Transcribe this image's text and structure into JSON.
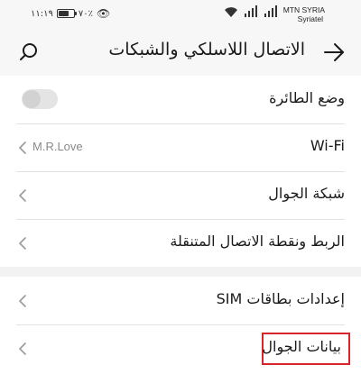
{
  "status_bar": {
    "time": "١١:١٩",
    "battery_text": "٧٠٪",
    "battery_level": 0.7,
    "carrier_name": "MTN SYRIA",
    "carrier_sub": "Syriatel"
  },
  "header": {
    "title": "الاتصال اللاسلكي والشبكات"
  },
  "settings": {
    "airplane": {
      "label": "وضع الطائرة",
      "enabled": false
    },
    "wifi": {
      "label": "Wi-Fi",
      "value": "M.R.Love"
    },
    "mobile_network": {
      "label": "شبكة الجوال"
    },
    "tethering": {
      "label": "الربط ونقطة الاتصال المتنقلة"
    },
    "sim_settings": {
      "label": "إعدادات بطاقات SIM"
    },
    "mobile_data": {
      "label": "بيانات الجوال"
    }
  },
  "colors": {
    "highlight": "#d6262b",
    "background": "#f2f2f2",
    "card": "#ffffff"
  }
}
